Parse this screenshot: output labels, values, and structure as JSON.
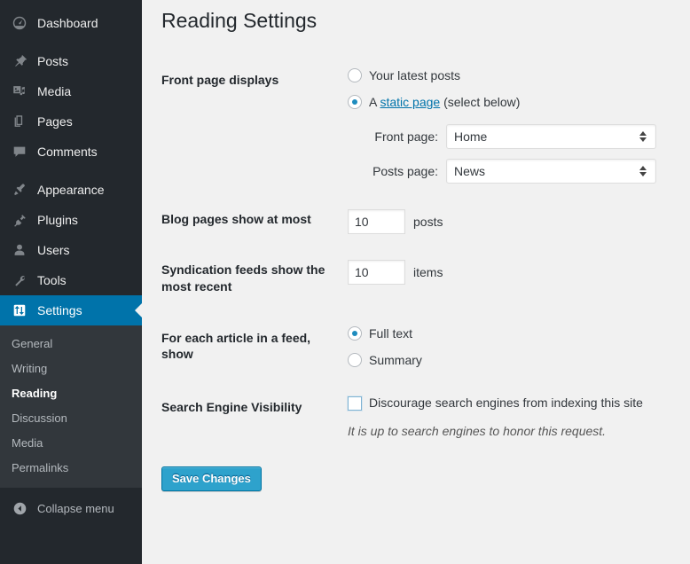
{
  "sidebar": {
    "primary": [
      {
        "label": "Dashboard",
        "icon": "dashboard-icon",
        "current": false
      },
      {
        "label": "Posts",
        "icon": "pushpin-icon",
        "current": false
      },
      {
        "label": "Media",
        "icon": "media-icon",
        "current": false
      },
      {
        "label": "Pages",
        "icon": "pages-icon",
        "current": false
      },
      {
        "label": "Comments",
        "icon": "comments-icon",
        "current": false
      },
      {
        "label": "Appearance",
        "icon": "paintbrush-icon",
        "current": false
      },
      {
        "label": "Plugins",
        "icon": "plug-icon",
        "current": false
      },
      {
        "label": "Users",
        "icon": "user-icon",
        "current": false
      },
      {
        "label": "Tools",
        "icon": "wrench-icon",
        "current": false
      },
      {
        "label": "Settings",
        "icon": "sliders-icon",
        "current": true
      }
    ],
    "submenu": [
      {
        "label": "General",
        "current": false
      },
      {
        "label": "Writing",
        "current": false
      },
      {
        "label": "Reading",
        "current": true
      },
      {
        "label": "Discussion",
        "current": false
      },
      {
        "label": "Media",
        "current": false
      },
      {
        "label": "Permalinks",
        "current": false
      }
    ],
    "collapse_label": "Collapse menu",
    "colors": {
      "background": "#23282d",
      "submenu_background": "#32373c",
      "current_highlight": "#0073aa",
      "text": "#eeeeee",
      "muted_text": "#b4b9be"
    }
  },
  "page": {
    "title": "Reading Settings"
  },
  "front_page": {
    "label": "Front page displays",
    "options": [
      {
        "text": "Your latest posts",
        "selected": false
      },
      {
        "text_before": "A ",
        "link_text": "static page",
        "text_after": " (select below)",
        "selected": true
      }
    ],
    "selects": [
      {
        "label": "Front page:",
        "value": "Home"
      },
      {
        "label": "Posts page:",
        "value": "News"
      }
    ]
  },
  "blog_pages": {
    "label": "Blog pages show at most",
    "value": "10",
    "unit": "posts"
  },
  "syndication": {
    "label": "Syndication feeds show the most recent",
    "value": "10",
    "unit": "items"
  },
  "feed_article": {
    "label": "For each article in a feed, show",
    "options": [
      {
        "text": "Full text",
        "selected": true
      },
      {
        "text": "Summary",
        "selected": false
      }
    ]
  },
  "search_visibility": {
    "label": "Search Engine Visibility",
    "checkbox_label": "Discourage search engines from indexing this site",
    "checked": false,
    "hint": "It is up to search engines to honor this request."
  },
  "submit": {
    "label": "Save Changes",
    "color": "#2ea2cc"
  }
}
